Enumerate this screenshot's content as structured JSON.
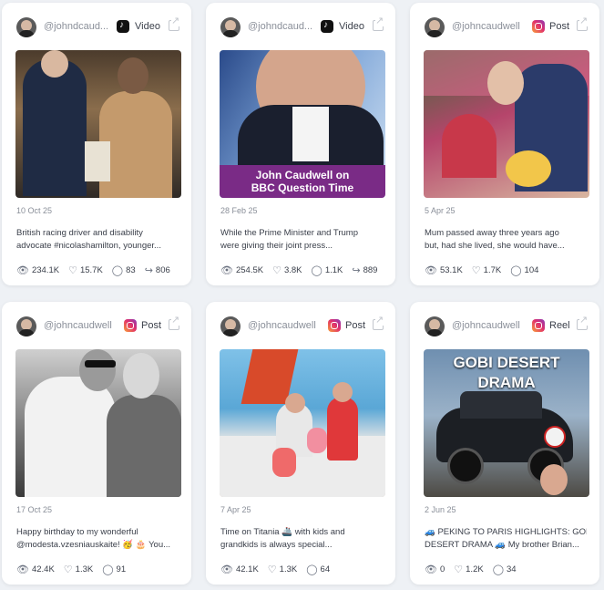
{
  "colors": {
    "background": "#eef1f5",
    "card": "#ffffff",
    "text": "#3a3f4a",
    "muted": "#8a8f99",
    "banner": "#7a2b86"
  },
  "cards": [
    {
      "username": "@johndcaud...",
      "platform_icon": "tiktok-icon",
      "type": "Video",
      "date": "10 Oct 25",
      "caption": [
        "British racing driver and disability",
        "advocate #nicolashamilton, younger..."
      ],
      "stats": {
        "views": "234.1K",
        "likes": "15.7K",
        "comments": "83",
        "shares": "806"
      }
    },
    {
      "username": "@johndcaud...",
      "platform_icon": "tiktok-icon",
      "type": "Video",
      "date": "28 Feb 25",
      "banner": [
        "John Caudwell on",
        "BBC Question Time"
      ],
      "caption": [
        "While the Prime Minister and Trump",
        "were giving their joint press..."
      ],
      "stats": {
        "views": "254.5K",
        "likes": "3.8K",
        "comments": "1.1K",
        "shares": "889"
      }
    },
    {
      "username": "@johncaudwell",
      "platform_icon": "instagram-icon",
      "type": "Post",
      "date": "5 Apr 25",
      "caption": [
        "Mum passed away three years ago",
        "but, had she lived, she would have..."
      ],
      "stats": {
        "views": "53.1K",
        "likes": "1.7K",
        "comments": "104"
      }
    },
    {
      "username": "@johncaudwell",
      "platform_icon": "instagram-icon",
      "type": "Post",
      "date": "17 Oct 25",
      "caption": [
        "Happy birthday to my wonderful",
        "@modesta.vzesniauskaite! 🥳 🎂 You..."
      ],
      "stats": {
        "views": "42.4K",
        "likes": "1.3K",
        "comments": "91"
      }
    },
    {
      "username": "@johncaudwell",
      "platform_icon": "instagram-icon",
      "type": "Post",
      "date": "7 Apr 25",
      "caption": [
        "Time on Titania 🚢 with kids and",
        "grandkids is always special..."
      ],
      "stats": {
        "views": "42.1K",
        "likes": "1.3K",
        "comments": "64"
      }
    },
    {
      "username": "@johncaudwell",
      "platform_icon": "instagram-icon",
      "type": "Reel",
      "date": "2 Jun 25",
      "overlay": [
        "GOBI DESERT",
        "DRAMA"
      ],
      "caption": [
        "🚙 PEKING TO PARIS HIGHLIGHTS: GOBI",
        "DESERT DRAMA 🚙 My brother Brian..."
      ],
      "stats": {
        "views": "0",
        "likes": "1.2K",
        "comments": "34"
      }
    }
  ]
}
